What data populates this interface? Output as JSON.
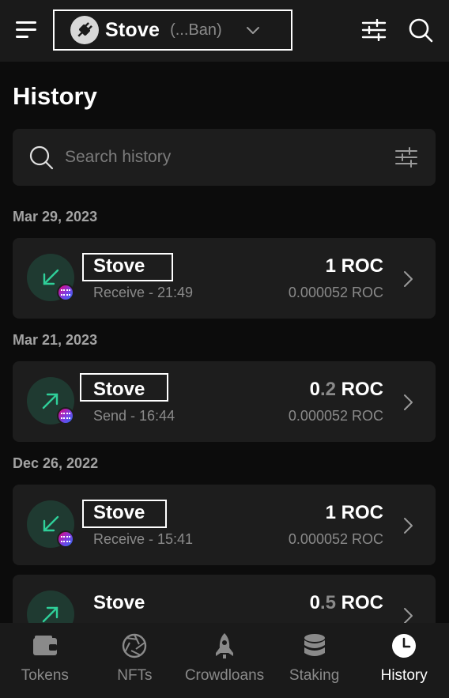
{
  "header": {
    "account_name": "Stove",
    "account_address": "(...Ban)"
  },
  "page": {
    "title": "History"
  },
  "search": {
    "placeholder": "Search history"
  },
  "groups": [
    {
      "date": "Mar 29, 2023"
    },
    {
      "date": "Mar 21, 2023"
    },
    {
      "date": "Dec 26, 2022"
    }
  ],
  "transactions": [
    {
      "name": "Stove",
      "subtitle": "Receive - 21:49",
      "amount_int": "1",
      "amount_dec": "",
      "token": "ROC",
      "fee": "0.000052 ROC",
      "direction": "receive"
    },
    {
      "name": "Stove",
      "subtitle": "Send - 16:44",
      "amount_int": "0",
      "amount_dec": ".2",
      "token": "ROC",
      "fee": "0.000052 ROC",
      "direction": "send"
    },
    {
      "name": "Stove",
      "subtitle": "Receive - 15:41",
      "amount_int": "1",
      "amount_dec": "",
      "token": "ROC",
      "fee": "0.000052 ROC",
      "direction": "receive"
    },
    {
      "name": "Stove",
      "subtitle": "",
      "amount_int": "0",
      "amount_dec": ".5",
      "token": "ROC",
      "fee": "",
      "direction": "send"
    }
  ],
  "nav": [
    {
      "label": "Tokens",
      "icon": "wallet-icon"
    },
    {
      "label": "NFTs",
      "icon": "aperture-icon"
    },
    {
      "label": "Crowdloans",
      "icon": "rocket-icon"
    },
    {
      "label": "Staking",
      "icon": "database-icon"
    },
    {
      "label": "History",
      "icon": "clock-icon"
    }
  ],
  "colors": {
    "background": "#0c0c0c",
    "surface": "#1d1d1d",
    "bar": "#1a1a1a",
    "accent_green": "#2fcf99",
    "icon_circle": "#1f3a31",
    "muted_text": "#8a8a8a"
  }
}
